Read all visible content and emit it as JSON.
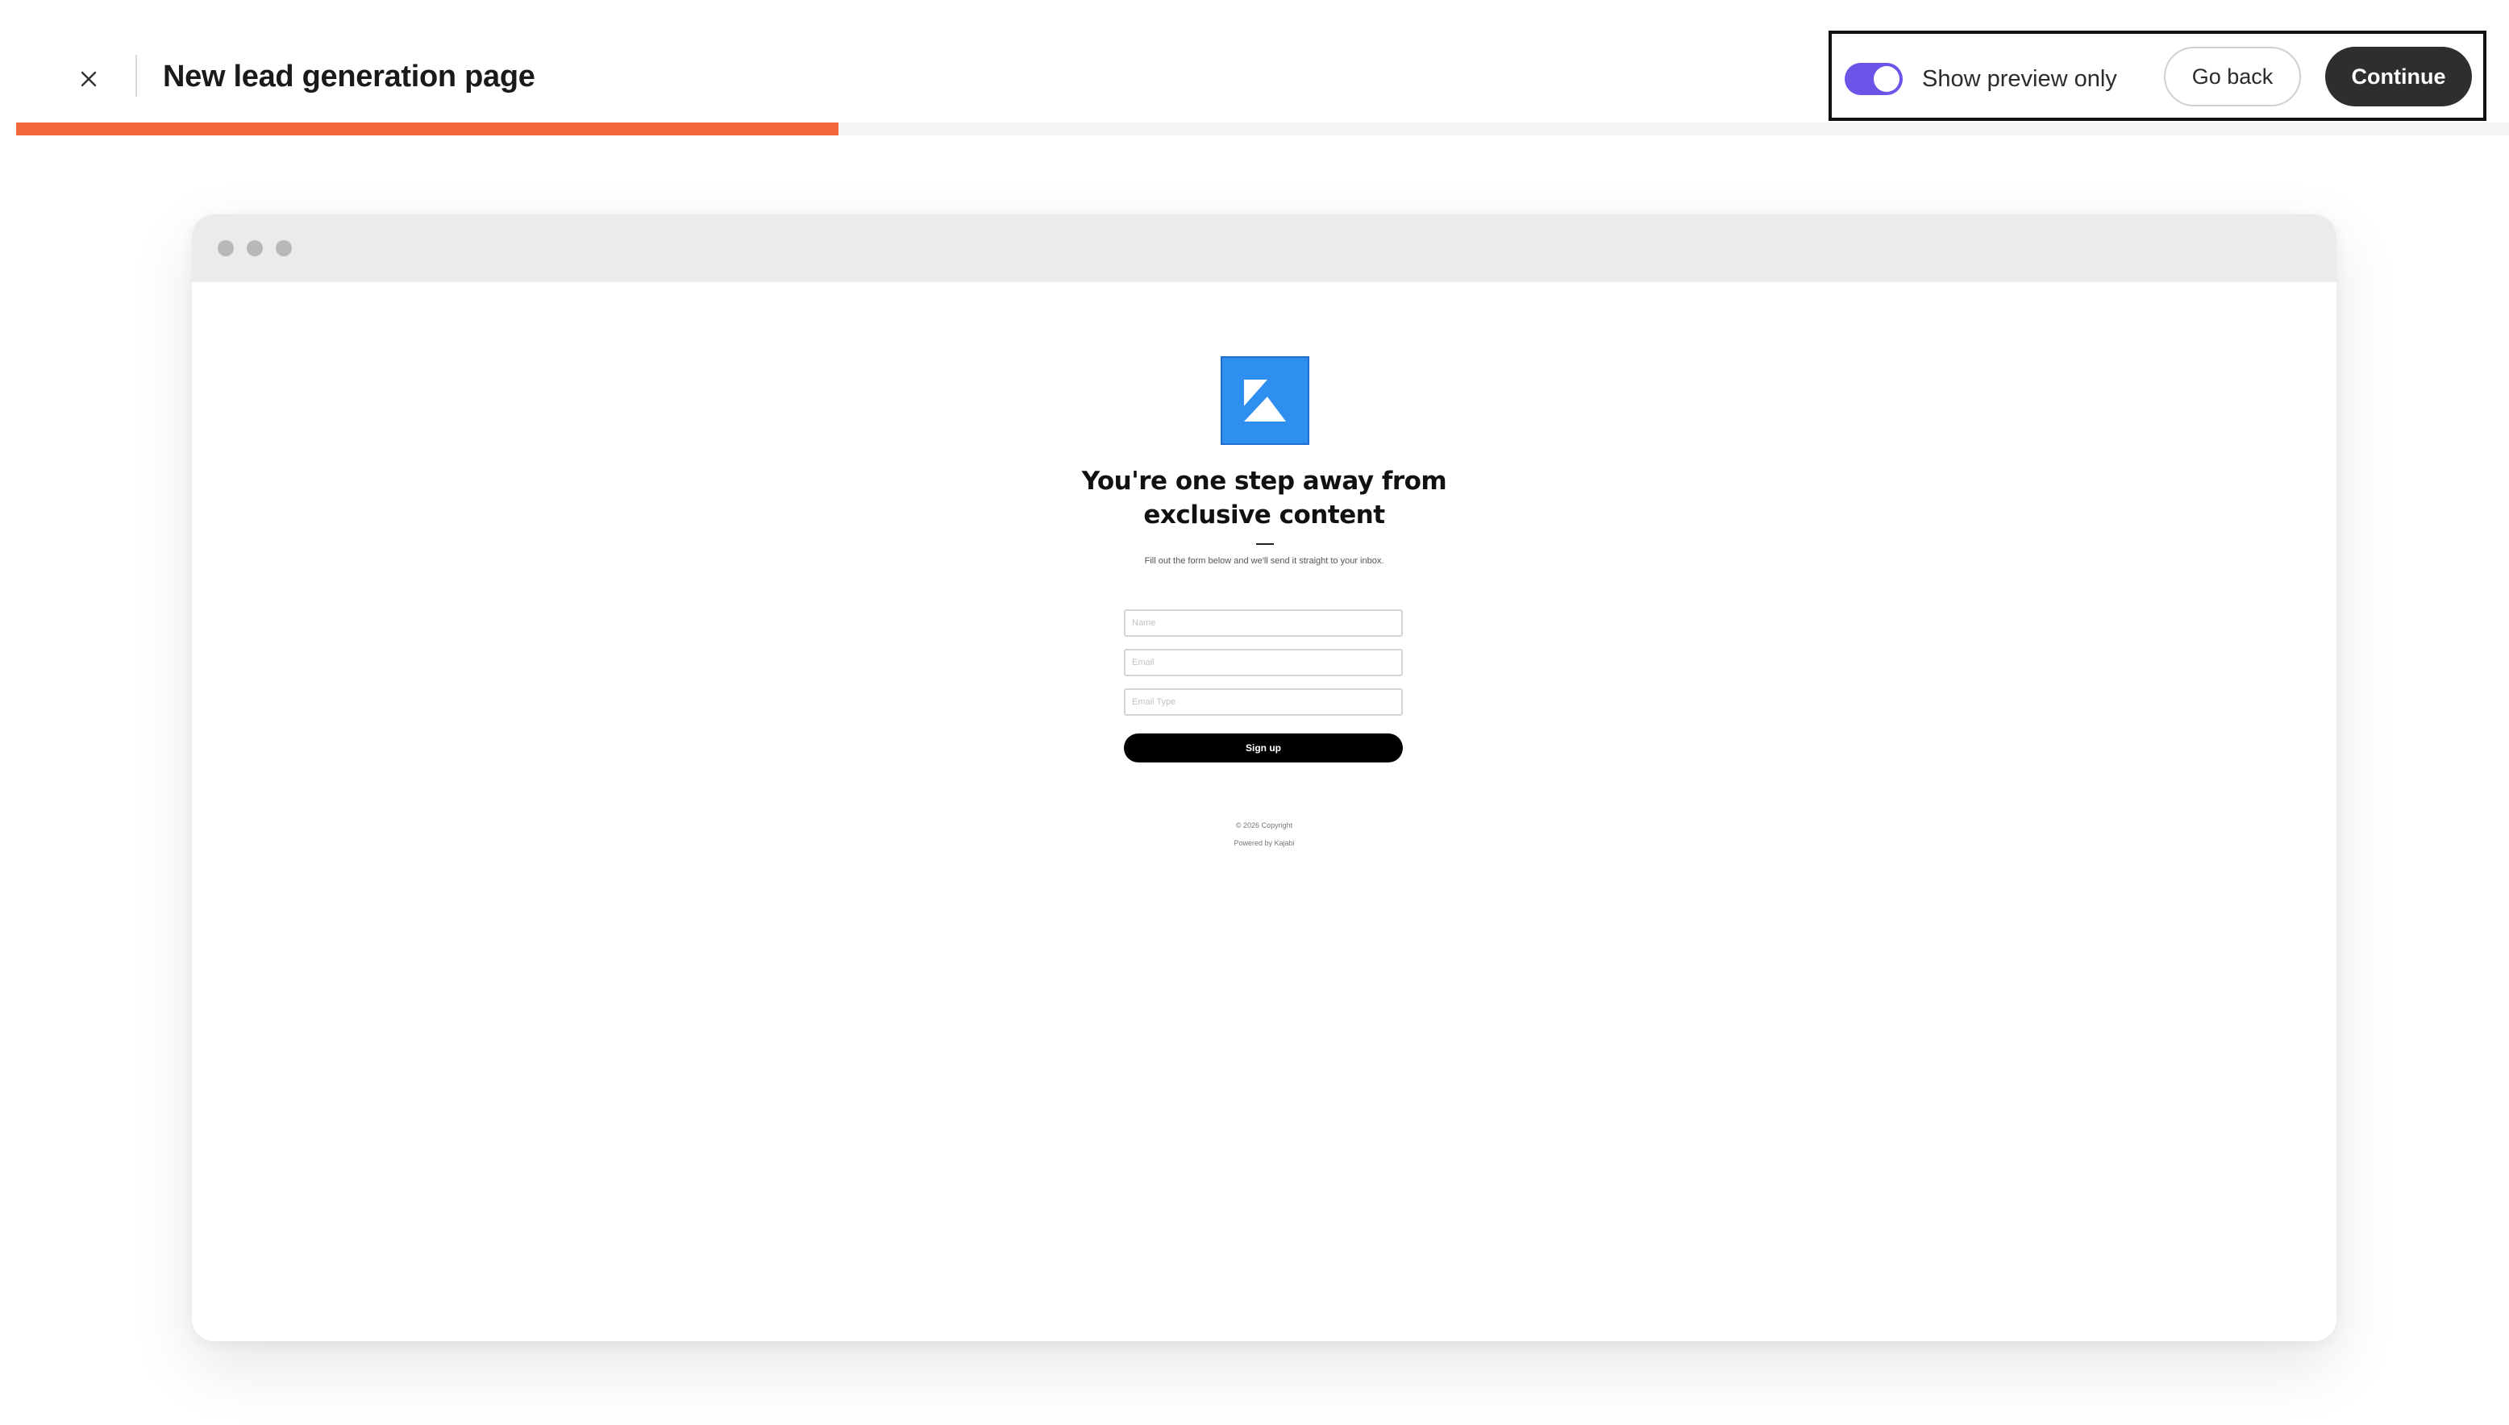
{
  "header": {
    "title": "New lead generation page",
    "close_icon": "close-icon"
  },
  "actions": {
    "toggle_label": "Show preview only",
    "toggle_on": true,
    "go_back_label": "Go back",
    "continue_label": "Continue"
  },
  "progress": {
    "fraction": 0.33
  },
  "preview": {
    "headline": "You're one step away from exclusive content",
    "subtext": "Fill out the form below and we'll send it straight to your inbox.",
    "fields": [
      {
        "placeholder": "Name"
      },
      {
        "placeholder": "Email"
      },
      {
        "placeholder": "Email Type"
      }
    ],
    "signup_label": "Sign up",
    "copyright": "© 2026 Copyright",
    "powered_by": "Powered by Kajabi"
  },
  "colors": {
    "accent": "#f2673a",
    "toggle": "#6a55e8",
    "primary_button": "#2e2e2e",
    "logo": "#2f8ff0"
  }
}
